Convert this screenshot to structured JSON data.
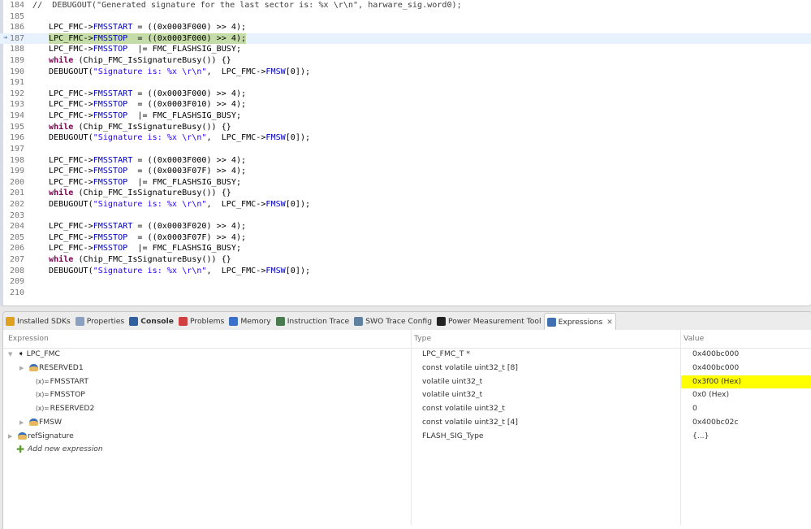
{
  "editor": {
    "current_line": 187,
    "lines": [
      {
        "n": "184",
        "indent": false,
        "segs": [
          [
            "comment",
            "//  DEBUGOUT(\"Generated signature for the last sector is: %x \\r\\n\", harware_sig.word0);"
          ]
        ]
      },
      {
        "n": "185",
        "indent": false,
        "segs": []
      },
      {
        "n": "186",
        "indent": true,
        "segs": [
          [
            "plain",
            "LPC_FMC->"
          ],
          [
            "field",
            "FMSSTART"
          ],
          [
            "plain",
            " = ((0x0003F000) >> 4);"
          ]
        ]
      },
      {
        "n": "187",
        "indent": true,
        "segs": [
          [
            "plain",
            "LPC_FMC->"
          ],
          [
            "field",
            "FMSSTOP"
          ],
          [
            "plain",
            "  = ((0x0003F000) >> 4);"
          ]
        ]
      },
      {
        "n": "188",
        "indent": true,
        "segs": [
          [
            "plain",
            "LPC_FMC->"
          ],
          [
            "field",
            "FMSSTOP"
          ],
          [
            "plain",
            "  |= FMC_FLASHSIG_BUSY;"
          ]
        ]
      },
      {
        "n": "189",
        "indent": true,
        "segs": [
          [
            "kw",
            "while"
          ],
          [
            "plain",
            " (Chip_FMC_IsSignatureBusy()) {}"
          ]
        ]
      },
      {
        "n": "190",
        "indent": true,
        "segs": [
          [
            "plain",
            "DEBUGOUT("
          ],
          [
            "str",
            "\"Signature is: %x \\r\\n\""
          ],
          [
            "plain",
            ",  LPC_FMC->"
          ],
          [
            "field",
            "FMSW"
          ],
          [
            "plain",
            "[0]);"
          ]
        ]
      },
      {
        "n": "191",
        "indent": false,
        "segs": []
      },
      {
        "n": "192",
        "indent": true,
        "segs": [
          [
            "plain",
            "LPC_FMC->"
          ],
          [
            "field",
            "FMSSTART"
          ],
          [
            "plain",
            " = ((0x0003F000) >> 4);"
          ]
        ]
      },
      {
        "n": "193",
        "indent": true,
        "segs": [
          [
            "plain",
            "LPC_FMC->"
          ],
          [
            "field",
            "FMSSTOP"
          ],
          [
            "plain",
            "  = ((0x0003F010) >> 4);"
          ]
        ]
      },
      {
        "n": "194",
        "indent": true,
        "segs": [
          [
            "plain",
            "LPC_FMC->"
          ],
          [
            "field",
            "FMSSTOP"
          ],
          [
            "plain",
            "  |= FMC_FLASHSIG_BUSY;"
          ]
        ]
      },
      {
        "n": "195",
        "indent": true,
        "segs": [
          [
            "kw",
            "while"
          ],
          [
            "plain",
            " (Chip_FMC_IsSignatureBusy()) {}"
          ]
        ]
      },
      {
        "n": "196",
        "indent": true,
        "segs": [
          [
            "plain",
            "DEBUGOUT("
          ],
          [
            "str",
            "\"Signature is: %x \\r\\n\""
          ],
          [
            "plain",
            ",  LPC_FMC->"
          ],
          [
            "field",
            "FMSW"
          ],
          [
            "plain",
            "[0]);"
          ]
        ]
      },
      {
        "n": "197",
        "indent": false,
        "segs": []
      },
      {
        "n": "198",
        "indent": true,
        "segs": [
          [
            "plain",
            "LPC_FMC->"
          ],
          [
            "field",
            "FMSSTART"
          ],
          [
            "plain",
            " = ((0x0003F000) >> 4);"
          ]
        ]
      },
      {
        "n": "199",
        "indent": true,
        "segs": [
          [
            "plain",
            "LPC_FMC->"
          ],
          [
            "field",
            "FMSSTOP"
          ],
          [
            "plain",
            "  = ((0x0003F07F) >> 4);"
          ]
        ]
      },
      {
        "n": "200",
        "indent": true,
        "segs": [
          [
            "plain",
            "LPC_FMC->"
          ],
          [
            "field",
            "FMSSTOP"
          ],
          [
            "plain",
            "  |= FMC_FLASHSIG_BUSY;"
          ]
        ]
      },
      {
        "n": "201",
        "indent": true,
        "segs": [
          [
            "kw",
            "while"
          ],
          [
            "plain",
            " (Chip_FMC_IsSignatureBusy()) {}"
          ]
        ]
      },
      {
        "n": "202",
        "indent": true,
        "segs": [
          [
            "plain",
            "DEBUGOUT("
          ],
          [
            "str",
            "\"Signature is: %x \\r\\n\""
          ],
          [
            "plain",
            ",  LPC_FMC->"
          ],
          [
            "field",
            "FMSW"
          ],
          [
            "plain",
            "[0]);"
          ]
        ]
      },
      {
        "n": "203",
        "indent": false,
        "segs": []
      },
      {
        "n": "204",
        "indent": true,
        "segs": [
          [
            "plain",
            "LPC_FMC->"
          ],
          [
            "field",
            "FMSSTART"
          ],
          [
            "plain",
            " = ((0x0003F020) >> 4);"
          ]
        ]
      },
      {
        "n": "205",
        "indent": true,
        "segs": [
          [
            "plain",
            "LPC_FMC->"
          ],
          [
            "field",
            "FMSSTOP"
          ],
          [
            "plain",
            "  = ((0x0003F07F) >> 4);"
          ]
        ]
      },
      {
        "n": "206",
        "indent": true,
        "segs": [
          [
            "plain",
            "LPC_FMC->"
          ],
          [
            "field",
            "FMSSTOP"
          ],
          [
            "plain",
            "  |= FMC_FLASHSIG_BUSY;"
          ]
        ]
      },
      {
        "n": "207",
        "indent": true,
        "segs": [
          [
            "kw",
            "while"
          ],
          [
            "plain",
            " (Chip_FMC_IsSignatureBusy()) {}"
          ]
        ]
      },
      {
        "n": "208",
        "indent": true,
        "segs": [
          [
            "plain",
            "DEBUGOUT("
          ],
          [
            "str",
            "\"Signature is: %x \\r\\n\""
          ],
          [
            "plain",
            ",  LPC_FMC->"
          ],
          [
            "field",
            "FMSW"
          ],
          [
            "plain",
            "[0]);"
          ]
        ]
      },
      {
        "n": "209",
        "indent": false,
        "segs": []
      },
      {
        "n": "210",
        "indent": false,
        "segs": []
      }
    ]
  },
  "tabs": [
    {
      "label": "Installed SDKs",
      "icon": "sdk-icon",
      "color": "#e0a020"
    },
    {
      "label": "Properties",
      "icon": "properties-icon",
      "color": "#8aa0c0"
    },
    {
      "label": "Console",
      "icon": "console-icon",
      "color": "#3060a0",
      "bold": true
    },
    {
      "label": "Problems",
      "icon": "problems-icon",
      "color": "#d04040"
    },
    {
      "label": "Memory",
      "icon": "memory-icon",
      "color": "#3a70c8"
    },
    {
      "label": "Instruction Trace",
      "icon": "instruction-trace-icon",
      "color": "#4a7a50"
    },
    {
      "label": "SWO Trace Config",
      "icon": "swo-icon",
      "color": "#6080a0"
    },
    {
      "label": "Power Measurement Tool",
      "icon": "battery-icon",
      "color": "#222222"
    },
    {
      "label": "Expressions",
      "icon": "expressions-icon",
      "color": "#4070b0",
      "active": true
    }
  ],
  "expressions": {
    "headers": {
      "expression": "Expression",
      "type": "Type",
      "value": "Value"
    },
    "rows": [
      {
        "name": "LPC_FMC",
        "type": "LPC_FMC_T *",
        "value": "0x400bc000",
        "level": 0,
        "twisty": "expanded",
        "icon": "pointer"
      },
      {
        "name": "RESERVED1",
        "type": "const volatile uint32_t [8]",
        "value": "0x400bc000",
        "level": 1,
        "twisty": "collapsed",
        "icon": "object"
      },
      {
        "name": "FMSSTART",
        "type": "volatile uint32_t",
        "value": "0x3f00 (Hex)",
        "level": 1,
        "twisty": "none",
        "icon": "variable",
        "changed": true
      },
      {
        "name": "FMSSTOP",
        "type": "volatile uint32_t",
        "value": "0x0 (Hex)",
        "level": 1,
        "twisty": "none",
        "icon": "variable"
      },
      {
        "name": "RESERVED2",
        "type": "const volatile uint32_t",
        "value": "0",
        "level": 1,
        "twisty": "none",
        "icon": "variable"
      },
      {
        "name": "FMSW",
        "type": "const volatile uint32_t [4]",
        "value": "0x400bc02c",
        "level": 1,
        "twisty": "collapsed",
        "icon": "object"
      },
      {
        "name": "refSignature",
        "type": "FLASH_SIG_Type",
        "value": "{...}",
        "level": 0,
        "twisty": "collapsed",
        "icon": "object"
      }
    ],
    "add_new": "Add new expression",
    "changed_color": "#ffff00"
  }
}
